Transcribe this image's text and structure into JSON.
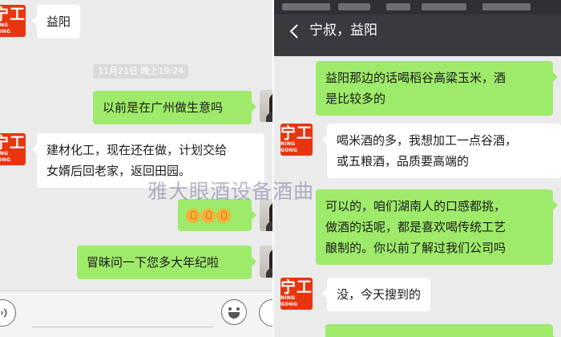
{
  "left_chat": {
    "messages": [
      {
        "from": "contact",
        "text": "益阳"
      },
      {
        "type": "timestamp",
        "text": "11月21日 晚上19:24"
      },
      {
        "from": "me",
        "text": "以前是在广州做生意吗"
      },
      {
        "from": "contact",
        "line1": "建材化工，现在还在做，计划交给",
        "line2": "女婿后回老家，返回田园。"
      },
      {
        "from": "me",
        "emoji": "thumbs-up-x3"
      },
      {
        "from": "me",
        "text": "冒昧问一下您多大年纪啦"
      }
    ],
    "input_bar": {
      "voice_icon": "voice-icon",
      "emoji_icon": "emoji-icon",
      "plus_icon": "plus-icon"
    }
  },
  "right_chat": {
    "header": {
      "title": "宁叔，益阳",
      "back_icon": "back-chevron-icon"
    },
    "messages": [
      {
        "from": "me",
        "line1": "益阳那边的话喝稻谷高粱玉米，酒",
        "line2": "是比较多的"
      },
      {
        "from": "contact",
        "line1": "喝米酒的多，我想加工一点谷酒，",
        "line2": "或五粮酒，品质要高端的"
      },
      {
        "from": "me",
        "line1": "可以的，咱们湖南人的口感都挑，",
        "line2": "做酒的话呢，都是喜欢喝传统工艺",
        "line3": "酿制的。你以前了解过我们公司吗"
      },
      {
        "from": "contact",
        "text": "没，今天搜到的"
      }
    ]
  },
  "avatar": {
    "brand_cn": "宁工",
    "brand_en": "NING GONG",
    "brand_color": "#e8350f"
  },
  "watermark": "雅大眼酒设备酒曲",
  "colors": {
    "my_bubble": "#9eea6a",
    "their_bubble": "#ffffff",
    "background": "#ebebeb",
    "header": "#39393e"
  }
}
